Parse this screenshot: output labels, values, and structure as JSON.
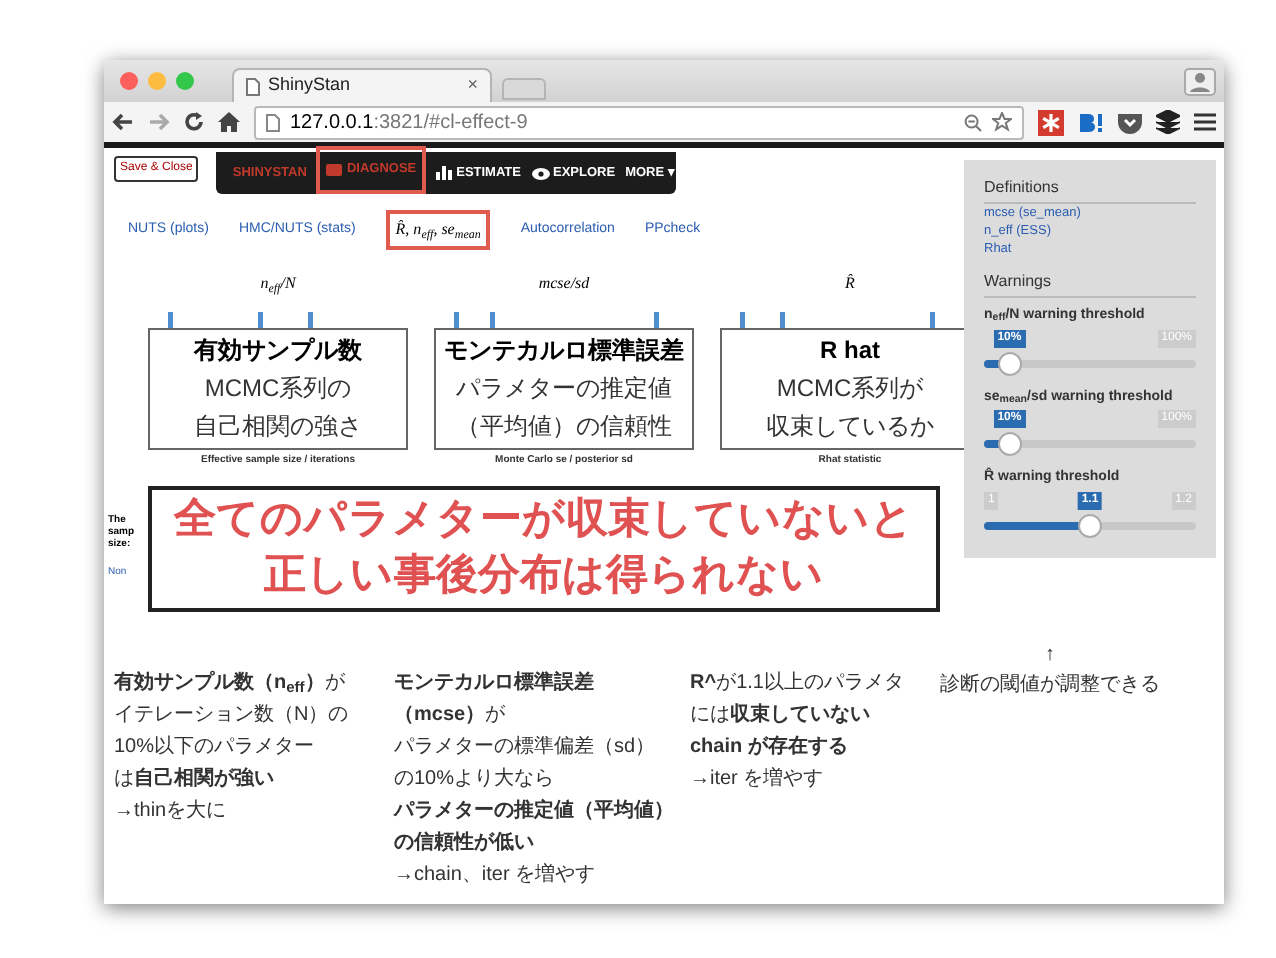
{
  "window": {
    "tab_title": "ShinyStan",
    "tab_close": "×",
    "url_host": "127.0.0.1",
    "url_rest": ":3821/#cl-effect-9"
  },
  "save_button": "Save & Close",
  "navbar": [
    {
      "label": "SHINYSTAN",
      "kind": "brand",
      "selected": false
    },
    {
      "label": "DIAGNOSE",
      "kind": "diagnose",
      "selected": true
    },
    {
      "label": "ESTIMATE",
      "kind": "estimate",
      "selected": false
    },
    {
      "label": "EXPLORE",
      "kind": "explore",
      "selected": false
    },
    {
      "label": "MORE ▾",
      "kind": "more",
      "selected": false
    }
  ],
  "tabs": [
    {
      "label": "NUTS (plots)",
      "selected": false
    },
    {
      "label": "HMC/NUTS (stats)",
      "selected": false
    },
    {
      "label": "R̂, n$_{eff}$, se$_{mean}$",
      "selected": true
    },
    {
      "label": "Autocorrelation",
      "selected": false
    },
    {
      "label": "PPcheck",
      "selected": false
    }
  ],
  "plots": [
    {
      "title": "n$_{eff}$/N",
      "caption": "Effective sample size / iterations",
      "callout": {
        "heading": "有効サンプル数",
        "lines": [
          "MCMC系列の",
          "自己相関の強さ"
        ]
      }
    },
    {
      "title": "mcse/sd",
      "caption": "Monte Carlo se / posterior sd",
      "callout": {
        "heading": "モンテカルロ標準誤差",
        "lines": [
          "パラメターの推定値",
          "（平均値）の信頼性"
        ]
      }
    },
    {
      "title": "R̂",
      "caption": "Rhat statistic",
      "callout": {
        "heading": "R hat",
        "lines": [
          "MCMC系列が",
          "収束しているか"
        ]
      }
    }
  ],
  "hidden_text": {
    "lines": [
      "The",
      "samp",
      "size:"
    ],
    "link": "Non"
  },
  "banner": [
    "全てのパラメターが収束していないと",
    "正しい事後分布は得られない"
  ],
  "sidebar": {
    "definitions_title": "Definitions",
    "definitions": [
      "mcse (se_mean)",
      "n_eff (ESS)",
      "Rhat"
    ],
    "warnings_title": "Warnings",
    "sliders": [
      {
        "label": "n$_{eff}$/N warning threshold",
        "value": "10%",
        "max": "100%",
        "level": 0.12
      },
      {
        "label": "se$_{mean}$/sd warning threshold",
        "value": "10%",
        "max": "100%",
        "level": 0.12
      },
      {
        "label": "R̂ warning threshold",
        "min": "1",
        "value": "1.1",
        "max": "1.2",
        "level": 0.5
      }
    ]
  },
  "notes": [
    {
      "lines": [
        "**有効サンプル数（n$_{eff}$）**が",
        "イテレーション数（N）の",
        "10%以下のパラメター",
        "は**自己相関が強い**",
        "→thinを大に"
      ]
    },
    {
      "lines": [
        "**モンテカルロ標準誤差**",
        "**（mcse）**が",
        "パラメターの標準偏差（sd）",
        "の10%より大なら",
        "**パラメターの推定値（平均値）**",
        "**の信頼性が低い**",
        "→chain、iter を増やす"
      ]
    },
    {
      "lines": [
        "**R^**が1.1以上のパラメタ",
        "には**収束していない**",
        "**chain が存在する**",
        "→iter を増やす"
      ]
    }
  ],
  "hint": {
    "arrow": "↑",
    "text": "診断の閾値が調整できる"
  }
}
